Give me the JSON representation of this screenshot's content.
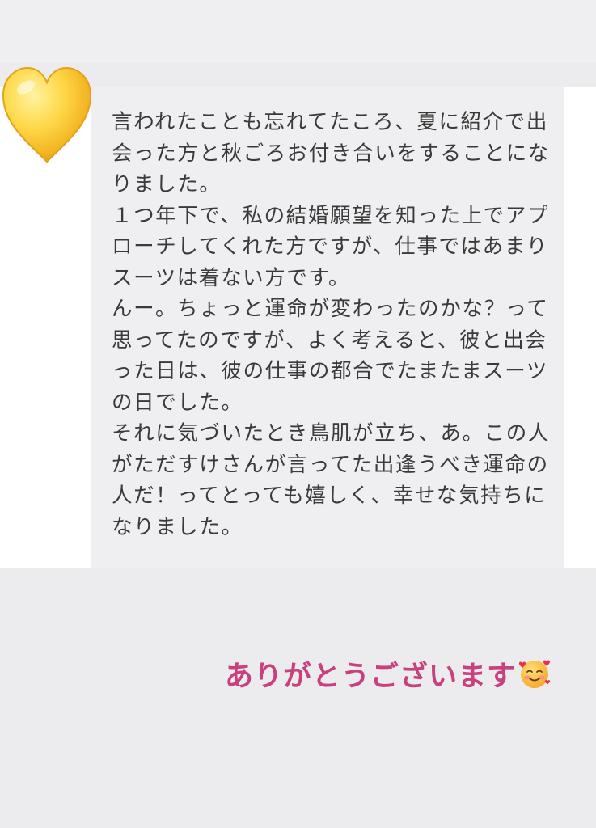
{
  "message": {
    "text": "言われたことも忘れてたころ、夏に紹介で出会った方と秋ごろお付き合いをすることになりました。\n１つ年下で、私の結婚願望を知った上でアプローチしてくれた方ですが、仕事ではあまりスーツは着ない方です。\nんー。ちょっと運命が変わったのかな？って思ってたのですが、よく考えると、彼と出会った日は、彼の仕事の都合でたまたまスーツの日でした。\nそれに気づいたとき鳥肌が立ち、あ。この人がただすけさんが言ってた出逢うべき運命の人だ！ってとっても嬉しく、幸せな気持ちになりました。"
  },
  "caption": {
    "text": "ありがとうございます",
    "color": "#c8407e"
  },
  "stickers": {
    "heart": "yellow-heart-emoji",
    "face": "smiling-face-with-hearts-emoji"
  },
  "colors": {
    "background": "#ececee",
    "bubble": "#efeff1",
    "text": "#3a3a3a"
  }
}
